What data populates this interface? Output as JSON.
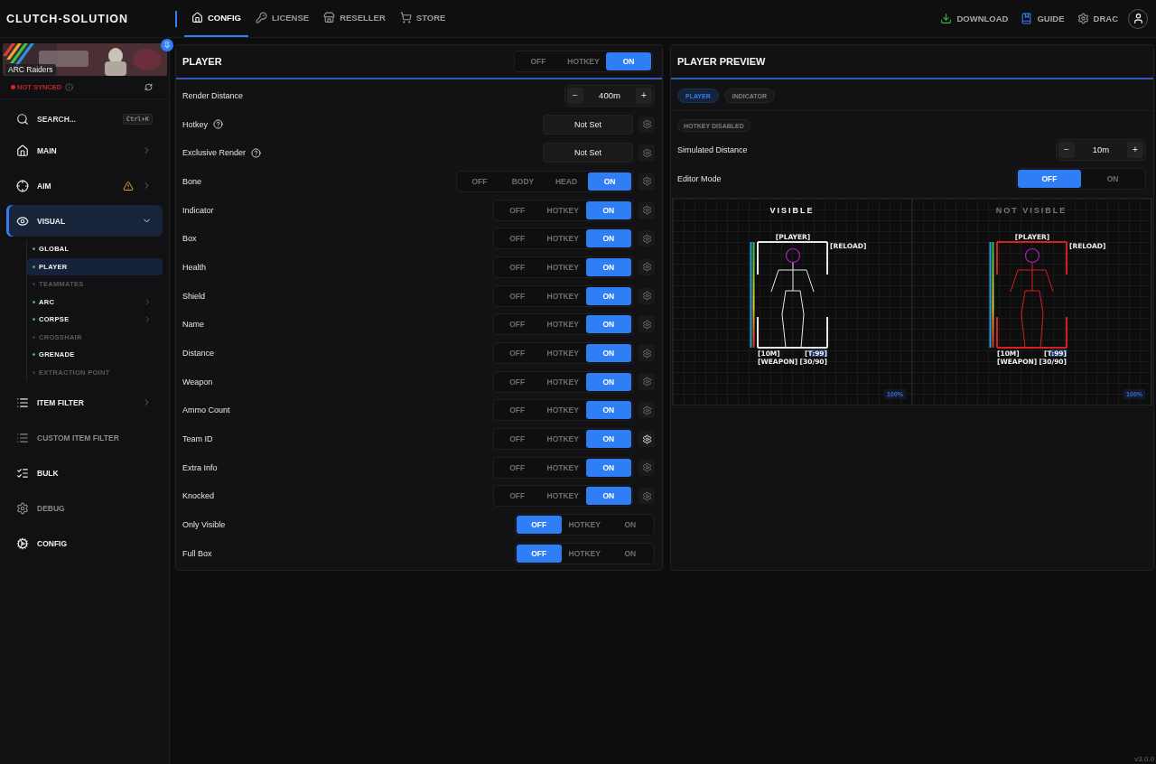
{
  "app": {
    "brand": "CLUTCH-SOLUTION",
    "version": "v3.0.0"
  },
  "nav_tabs": [
    {
      "label": "CONFIG",
      "selected": true
    },
    {
      "label": "LICENSE",
      "selected": false
    },
    {
      "label": "RESELLER",
      "selected": false
    },
    {
      "label": "STORE",
      "selected": false
    }
  ],
  "top_links": [
    {
      "label": "DOWNLOAD"
    },
    {
      "label": "GUIDE"
    },
    {
      "label": "DRAC"
    }
  ],
  "game": {
    "name": "ARC Raiders",
    "pinned": true
  },
  "sync": {
    "status": "NOT SYNCED",
    "synced": false
  },
  "search": {
    "label": "SEARCH...",
    "shortcut": "Ctrl+K"
  },
  "sidebar": {
    "items": [
      {
        "label": "MAIN",
        "selected": false,
        "dimmed": false,
        "warning": false,
        "expandable": true,
        "expanded": false
      },
      {
        "label": "AIM",
        "selected": false,
        "dimmed": false,
        "warning": true,
        "expandable": true,
        "expanded": false
      },
      {
        "label": "VISUAL",
        "selected": true,
        "dimmed": false,
        "warning": false,
        "expandable": true,
        "expanded": true,
        "children": [
          {
            "label": "GLOBAL",
            "enabled": true,
            "selected": false,
            "expandable": false
          },
          {
            "label": "PLAYER",
            "enabled": true,
            "selected": true,
            "expandable": false
          },
          {
            "label": "TEAMMATES",
            "enabled": false,
            "selected": false,
            "expandable": false
          },
          {
            "label": "ARC",
            "enabled": true,
            "selected": false,
            "expandable": true
          },
          {
            "label": "CORPSE",
            "enabled": true,
            "selected": false,
            "expandable": true
          },
          {
            "label": "CROSSHAIR",
            "enabled": false,
            "selected": false,
            "expandable": false
          },
          {
            "label": "GRENADE",
            "enabled": true,
            "selected": false,
            "expandable": false
          },
          {
            "label": "EXTRACTION POINT",
            "enabled": false,
            "selected": false,
            "expandable": false
          }
        ]
      },
      {
        "label": "ITEM FILTER",
        "selected": false,
        "dimmed": false,
        "warning": false,
        "expandable": true,
        "expanded": false
      },
      {
        "label": "CUSTOM ITEM FILTER",
        "selected": false,
        "dimmed": true,
        "warning": false,
        "expandable": false,
        "expanded": false
      },
      {
        "label": "BULK",
        "selected": false,
        "dimmed": false,
        "warning": false,
        "expandable": false,
        "expanded": false
      },
      {
        "label": "DEBUG",
        "selected": false,
        "dimmed": true,
        "warning": false,
        "expandable": false,
        "expanded": false
      },
      {
        "label": "CONFIG",
        "selected": false,
        "dimmed": false,
        "warning": false,
        "expandable": false,
        "expanded": false
      }
    ]
  },
  "player_panel": {
    "title": "PLAYER",
    "mode": [
      {
        "label": "OFF",
        "selected": false
      },
      {
        "label": "HOTKEY",
        "selected": false
      },
      {
        "label": "ON",
        "selected": true
      }
    ],
    "rows": [
      {
        "kind": "stepper",
        "label": "Render Distance",
        "value": "400m",
        "decrement": "−",
        "increment": "+"
      },
      {
        "kind": "keybind",
        "label": "Hotkey",
        "value": "Not Set"
      },
      {
        "kind": "keybind",
        "label": "Exclusive Render",
        "value": "Not Set"
      },
      {
        "kind": "segmented",
        "label": "Bone",
        "gear": true,
        "gear_active": false,
        "options": [
          {
            "label": "OFF",
            "selected": false
          },
          {
            "label": "BODY",
            "selected": false
          },
          {
            "label": "HEAD",
            "selected": false
          },
          {
            "label": "ON",
            "selected": true
          }
        ]
      },
      {
        "kind": "segmented",
        "label": "Indicator",
        "gear": true,
        "gear_active": false,
        "options": [
          {
            "label": "OFF",
            "selected": false
          },
          {
            "label": "HOTKEY",
            "selected": false
          },
          {
            "label": "ON",
            "selected": true
          }
        ]
      },
      {
        "kind": "segmented",
        "label": "Box",
        "gear": true,
        "gear_active": false,
        "options": [
          {
            "label": "OFF",
            "selected": false
          },
          {
            "label": "HOTKEY",
            "selected": false
          },
          {
            "label": "ON",
            "selected": true
          }
        ]
      },
      {
        "kind": "segmented",
        "label": "Health",
        "gear": true,
        "gear_active": false,
        "options": [
          {
            "label": "OFF",
            "selected": false
          },
          {
            "label": "HOTKEY",
            "selected": false
          },
          {
            "label": "ON",
            "selected": true
          }
        ]
      },
      {
        "kind": "segmented",
        "label": "Shield",
        "gear": true,
        "gear_active": false,
        "options": [
          {
            "label": "OFF",
            "selected": false
          },
          {
            "label": "HOTKEY",
            "selected": false
          },
          {
            "label": "ON",
            "selected": true
          }
        ]
      },
      {
        "kind": "segmented",
        "label": "Name",
        "gear": true,
        "gear_active": false,
        "options": [
          {
            "label": "OFF",
            "selected": false
          },
          {
            "label": "HOTKEY",
            "selected": false
          },
          {
            "label": "ON",
            "selected": true
          }
        ]
      },
      {
        "kind": "segmented",
        "label": "Distance",
        "gear": true,
        "gear_active": false,
        "options": [
          {
            "label": "OFF",
            "selected": false
          },
          {
            "label": "HOTKEY",
            "selected": false
          },
          {
            "label": "ON",
            "selected": true
          }
        ]
      },
      {
        "kind": "segmented",
        "label": "Weapon",
        "gear": true,
        "gear_active": false,
        "options": [
          {
            "label": "OFF",
            "selected": false
          },
          {
            "label": "HOTKEY",
            "selected": false
          },
          {
            "label": "ON",
            "selected": true
          }
        ]
      },
      {
        "kind": "segmented",
        "label": "Ammo Count",
        "gear": true,
        "gear_active": false,
        "options": [
          {
            "label": "OFF",
            "selected": false
          },
          {
            "label": "HOTKEY",
            "selected": false
          },
          {
            "label": "ON",
            "selected": true
          }
        ]
      },
      {
        "kind": "segmented",
        "label": "Team ID",
        "gear": true,
        "gear_active": true,
        "options": [
          {
            "label": "OFF",
            "selected": false
          },
          {
            "label": "HOTKEY",
            "selected": false
          },
          {
            "label": "ON",
            "selected": true
          }
        ]
      },
      {
        "kind": "segmented",
        "label": "Extra Info",
        "gear": true,
        "gear_active": false,
        "options": [
          {
            "label": "OFF",
            "selected": false
          },
          {
            "label": "HOTKEY",
            "selected": false
          },
          {
            "label": "ON",
            "selected": true
          }
        ]
      },
      {
        "kind": "segmented",
        "label": "Knocked",
        "gear": true,
        "gear_active": false,
        "options": [
          {
            "label": "OFF",
            "selected": false
          },
          {
            "label": "HOTKEY",
            "selected": false
          },
          {
            "label": "ON",
            "selected": true
          }
        ]
      },
      {
        "kind": "segmented",
        "label": "Only Visible",
        "gear": false,
        "options": [
          {
            "label": "OFF",
            "selected": true
          },
          {
            "label": "HOTKEY",
            "selected": false
          },
          {
            "label": "ON",
            "selected": false
          }
        ]
      },
      {
        "kind": "segmented",
        "label": "Full Box",
        "gear": false,
        "options": [
          {
            "label": "OFF",
            "selected": true
          },
          {
            "label": "HOTKEY",
            "selected": false
          },
          {
            "label": "ON",
            "selected": false
          }
        ]
      }
    ]
  },
  "preview_panel": {
    "title": "PLAYER PREVIEW",
    "tabs": [
      {
        "label": "PLAYER",
        "selected": true
      },
      {
        "label": "INDICATOR",
        "selected": false
      }
    ],
    "badge": "HOTKEY DISABLED",
    "rows": [
      {
        "kind": "stepper",
        "label": "Simulated Distance",
        "value": "10m",
        "decrement": "−",
        "increment": "+"
      },
      {
        "kind": "wide",
        "label": "Editor Mode",
        "options": [
          {
            "label": "OFF",
            "selected": true
          },
          {
            "label": "ON",
            "selected": false
          }
        ]
      }
    ],
    "canvases": [
      {
        "title": "VISIBLE",
        "highlighted": true,
        "color": "#e6e6e6",
        "labels": [
          "[PLAYER]",
          "[RELOAD]",
          "[10M]",
          "[T:99]",
          "[WEAPON]",
          "[30/90]"
        ],
        "zoom": "100%"
      },
      {
        "title": "NOT VISIBLE",
        "highlighted": false,
        "color": "#d42020",
        "labels": [
          "[PLAYER]",
          "[RELOAD]",
          "[10M]",
          "[T:99]",
          "[WEAPON]",
          "[30/90]"
        ],
        "zoom": "100%"
      }
    ]
  }
}
